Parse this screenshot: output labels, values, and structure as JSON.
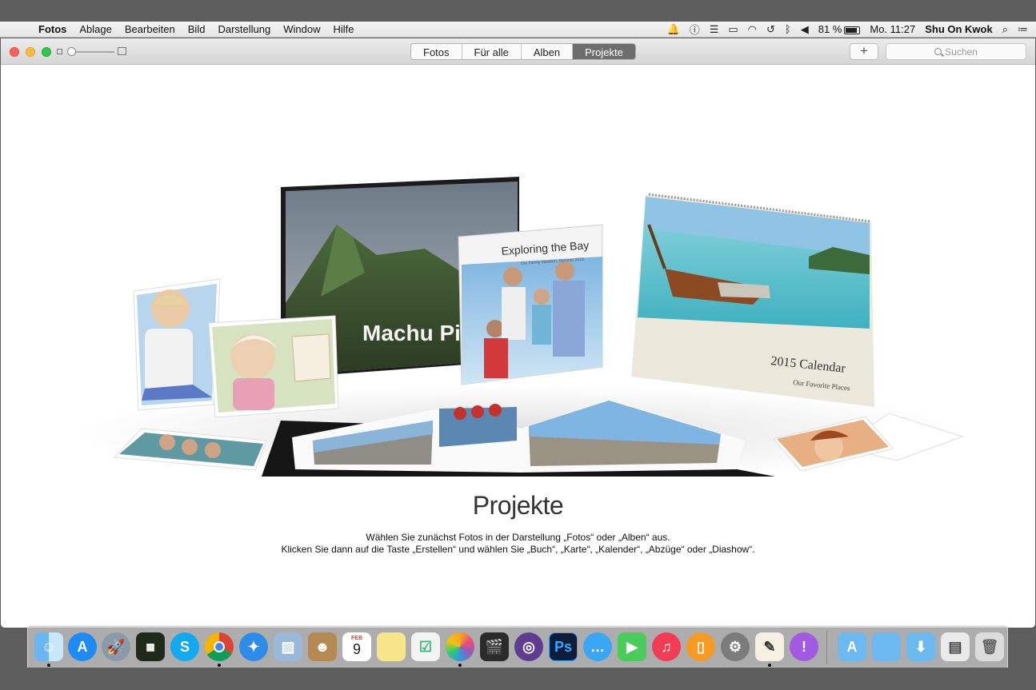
{
  "menubar": {
    "app_name": "Fotos",
    "menus": [
      "Ablage",
      "Bearbeiten",
      "Bild",
      "Darstellung",
      "Window",
      "Hilfe"
    ],
    "battery": "81 %",
    "clock": "Mo. 11:27",
    "user": "Shu On Kwok"
  },
  "toolbar": {
    "tabs": [
      "Fotos",
      "Für alle",
      "Alben",
      "Projekte"
    ],
    "active_tab": "Projekte",
    "add_label": "+",
    "search_placeholder": "Suchen"
  },
  "illustration": {
    "book_title": "Machu Pi",
    "book2_title": "Exploring the Bay",
    "book2_subtitle": "Our Family Vacation, Summer 2016",
    "calendar_title": "2015 Calendar",
    "calendar_subtitle": "Our Favorite Places"
  },
  "main": {
    "title": "Projekte",
    "line1": "Wählen Sie zunächst Fotos in der Darstellung „Fotos“ oder „Alben“ aus.",
    "line2": "Klicken Sie dann auf die Taste „Erstellen“ und wählen Sie „Buch“, „Karte“, „Kalender“, „Abzüge“ oder „Diashow“."
  },
  "dock": {
    "calendar_month": "FEB",
    "calendar_day": "9",
    "items": [
      "finder",
      "app-store",
      "launchpad",
      "mission-control",
      "skype",
      "chrome",
      "safari",
      "preview",
      "contacts",
      "calendar",
      "notes",
      "reminders",
      "photos",
      "final-cut",
      "motion",
      "photoshop",
      "messages",
      "facetime",
      "itunes",
      "ibooks",
      "system-preferences",
      "textedit",
      "feedback",
      "applications",
      "documents",
      "downloads",
      "finder-window",
      "trash"
    ]
  },
  "colors": {
    "accent_tab": "#6e6e6e",
    "close": "#fc605b",
    "minimize": "#fdbc40",
    "maximize": "#34c84a"
  }
}
